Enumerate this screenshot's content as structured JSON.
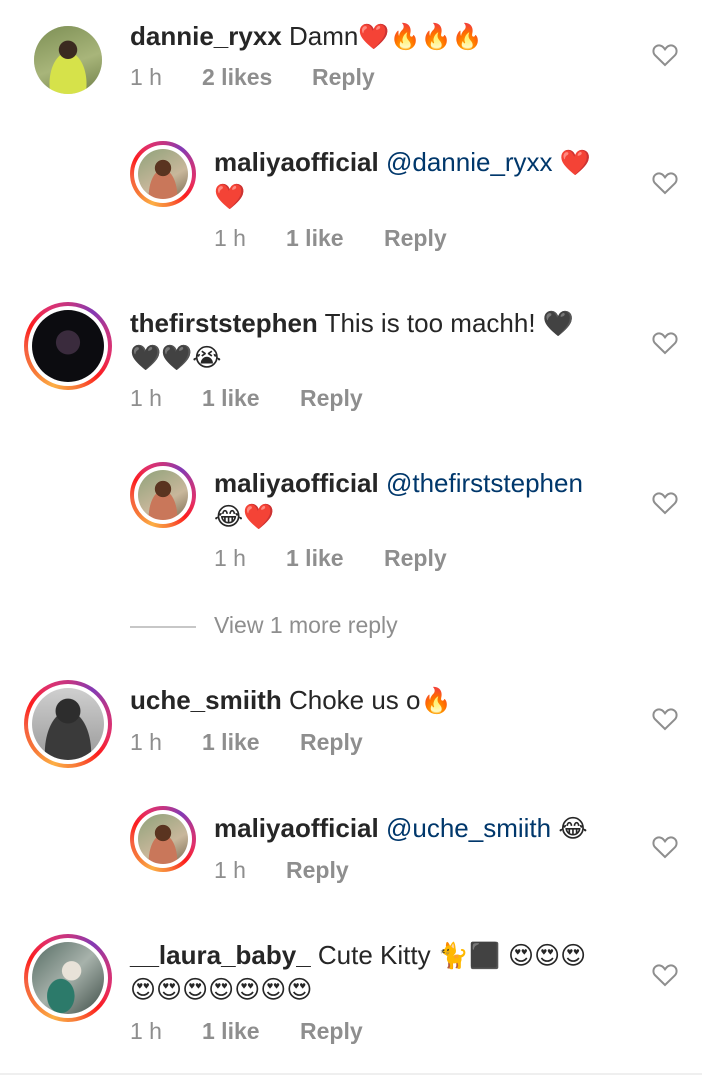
{
  "comments": [
    {
      "username": "dannie_ryxx",
      "text": "Damn",
      "emojis": "❤️🔥🔥🔥",
      "emojis_line2": "",
      "time": "1 h",
      "likes": "2 likes",
      "reply": "Reply",
      "avatar": "dannie-avatar"
    },
    {
      "username": "maliyaofficial",
      "mention": "@dannie_ryxx",
      "emojis": "❤️",
      "emojis_line2": "❤️",
      "time": "1 h",
      "likes": "1 like",
      "reply": "Reply",
      "avatar": "maliya-avatar"
    },
    {
      "username": "thefirststephen",
      "text": "This is too machh!",
      "emojis": "🖤",
      "emojis_line2": "🖤🖤😭",
      "time": "1 h",
      "likes": "1 like",
      "reply": "Reply",
      "avatar": "stephen-avatar"
    },
    {
      "username": "maliyaofficial",
      "mention": "@thefirststephen",
      "emojis": "",
      "emojis_line2": "😂❤️",
      "time": "1 h",
      "likes": "1 like",
      "reply": "Reply",
      "avatar": "maliya-avatar"
    },
    {
      "username": "uche_smiith",
      "text": "Choke us o",
      "emojis": "🔥",
      "emojis_line2": "",
      "time": "1 h",
      "likes": "1 like",
      "reply": "Reply",
      "avatar": "uche-avatar"
    },
    {
      "username": "maliyaofficial",
      "mention": "@uche_smiith",
      "emojis": "😂",
      "emojis_line2": "",
      "time": "1 h",
      "likes": "",
      "reply": "Reply",
      "avatar": "maliya-avatar"
    },
    {
      "username": "__laura_baby_",
      "text": "Cute Kitty",
      "emojis": "🐈⬛ 😍😍😍",
      "emojis_line2": "😍😍😍😍😍😍😍",
      "time": "1 h",
      "likes": "1 like",
      "reply": "Reply",
      "avatar": "laura-avatar"
    }
  ],
  "view_more_replies": "View 1 more reply",
  "colors": {
    "text": "#262626",
    "meta": "#8e8e8e",
    "mention": "#00376b",
    "heart_outline": "#8e8e8e"
  },
  "icons": {
    "like": "heart-outline-icon"
  }
}
